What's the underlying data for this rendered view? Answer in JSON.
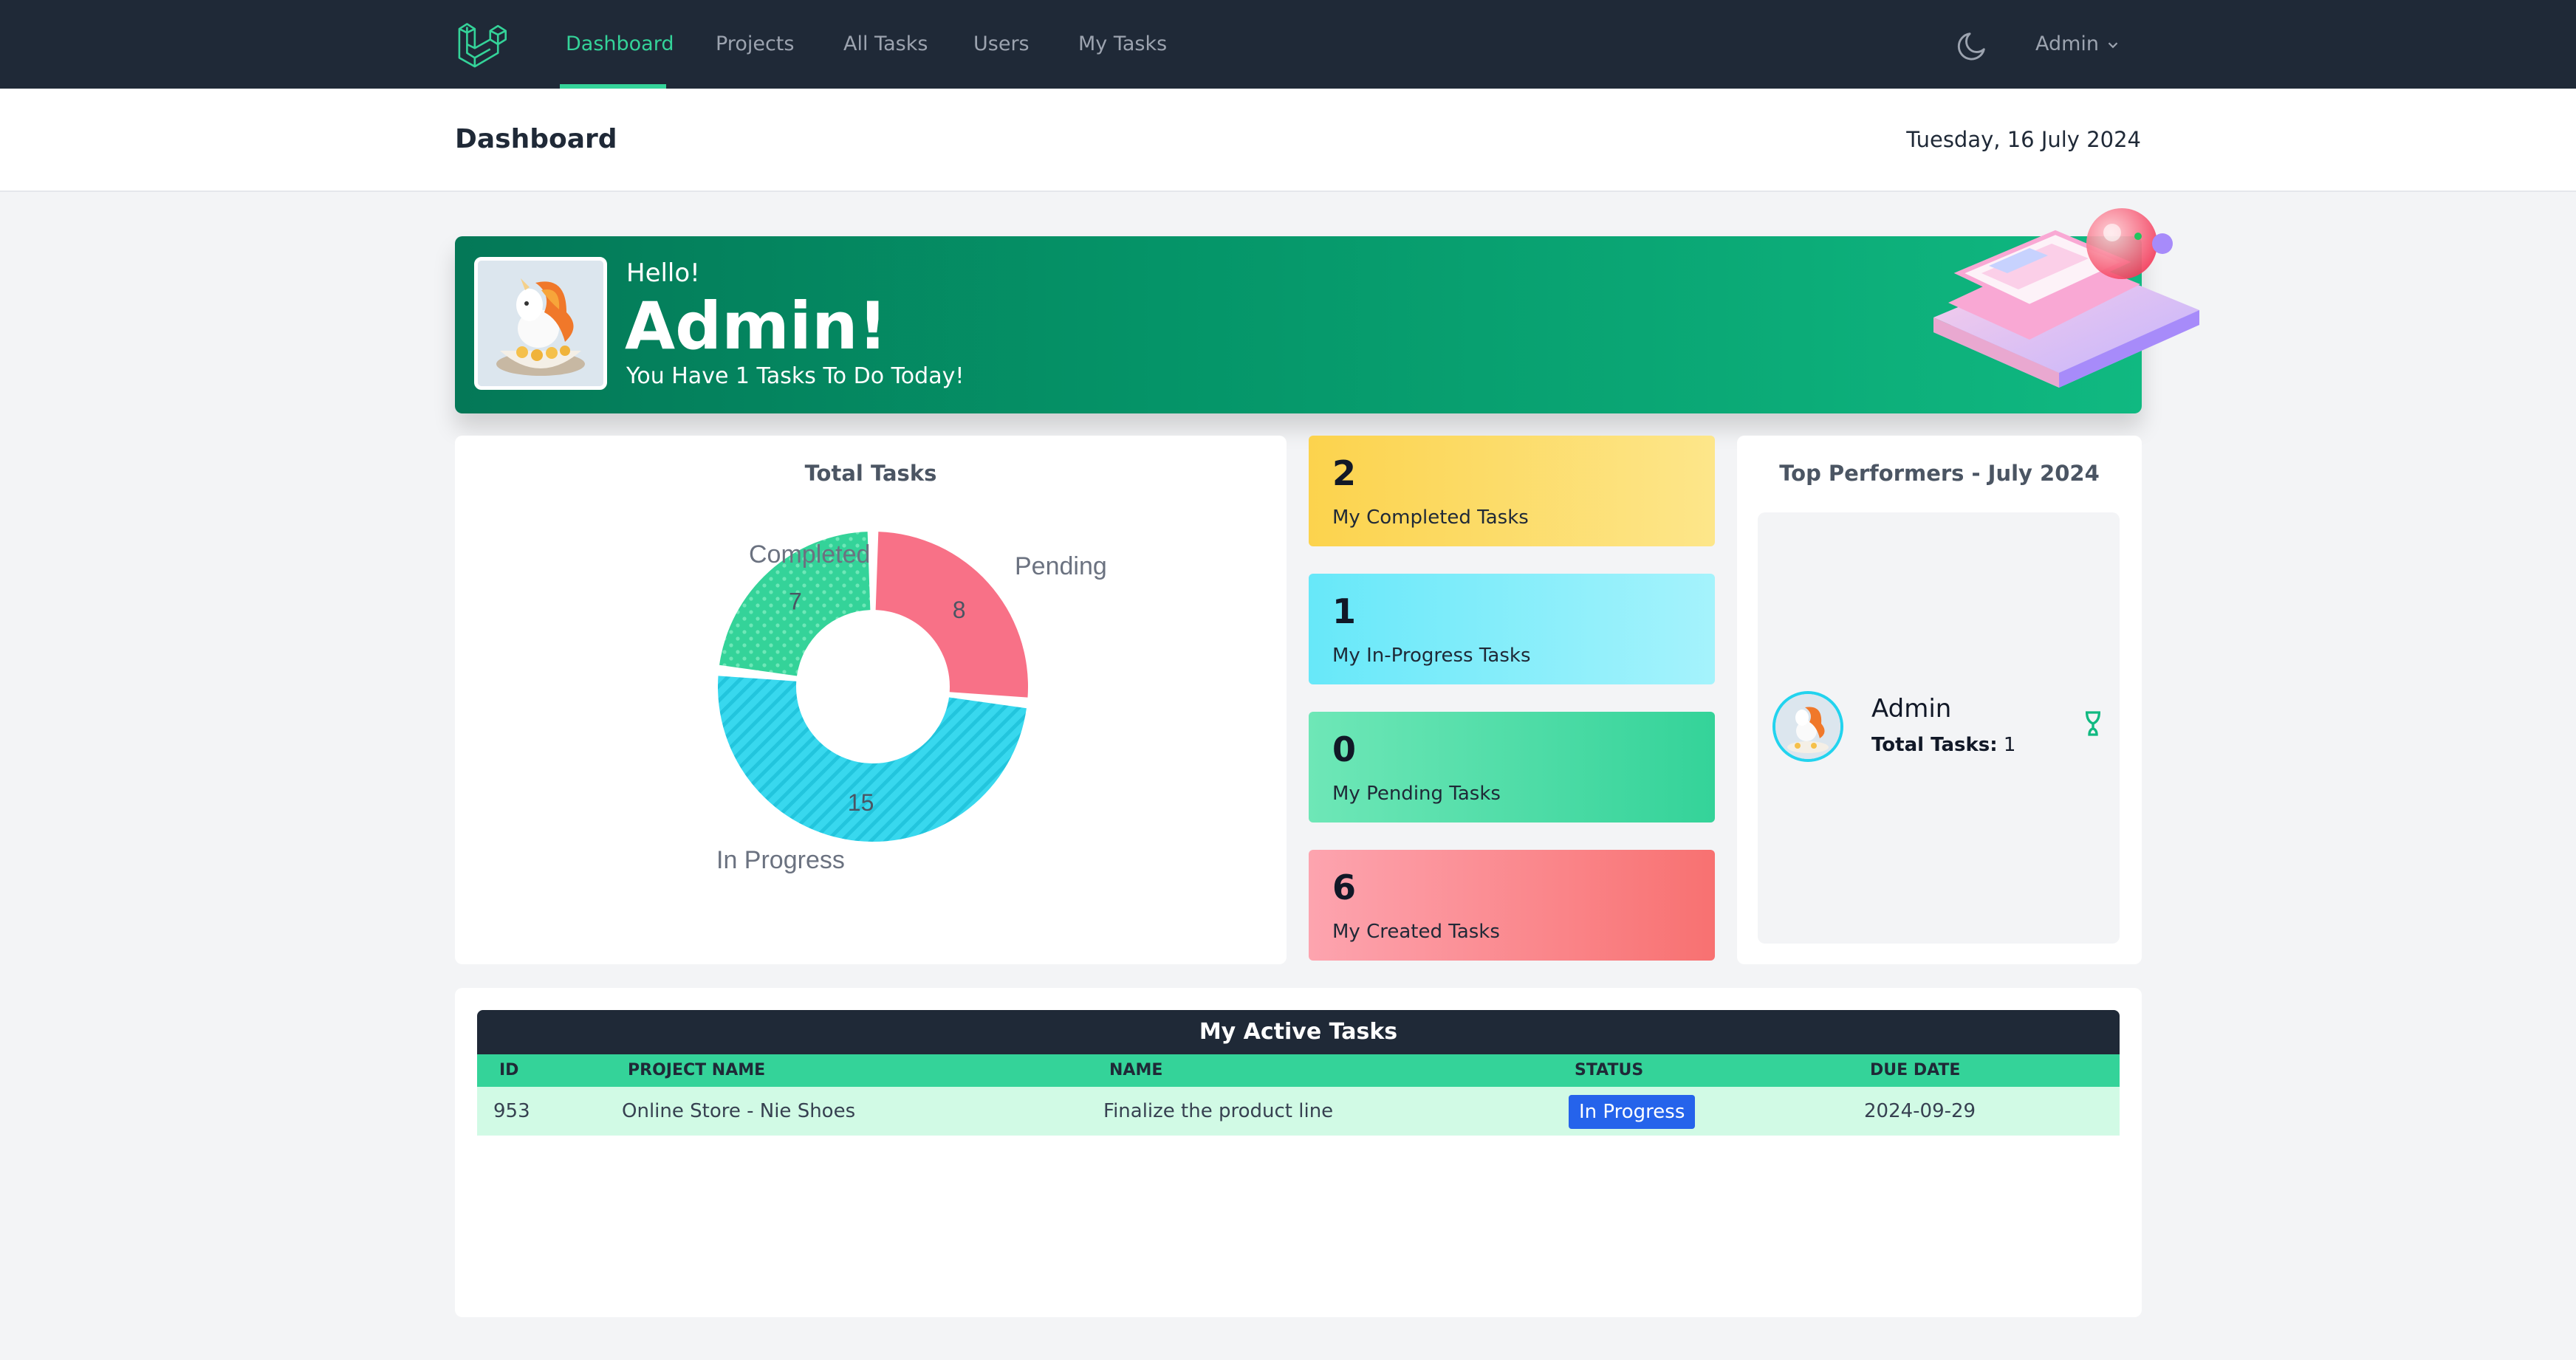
{
  "nav": {
    "items": [
      {
        "label": "Dashboard",
        "active": true
      },
      {
        "label": "Projects",
        "active": false
      },
      {
        "label": "All Tasks",
        "active": false
      },
      {
        "label": "Users",
        "active": false
      },
      {
        "label": "My Tasks",
        "active": false
      }
    ],
    "user": "Admin",
    "accent_color": "#34d399"
  },
  "header": {
    "title": "Dashboard",
    "date": "Tuesday, 16 July 2024"
  },
  "banner": {
    "greeting": "Hello!",
    "name": "Admin!",
    "subtitle": "You Have 1 Tasks To Do Today!"
  },
  "total_tasks": {
    "title": "Total Tasks"
  },
  "chart_data": {
    "type": "pie",
    "title": "Total Tasks",
    "categories": [
      "Pending",
      "In Progress",
      "Completed"
    ],
    "values": [
      8,
      15,
      7
    ],
    "colors": [
      "#f87187",
      "#38d8ee",
      "#34d399"
    ],
    "donut": true
  },
  "stats": [
    {
      "value": "2",
      "label": "My Completed Tasks",
      "from": "#fcd34d",
      "to": "#fde68a"
    },
    {
      "value": "1",
      "label": "My In-Progress Tasks",
      "from": "#67e8f9",
      "to": "#a5f3fc"
    },
    {
      "value": "0",
      "label": "My Pending Tasks",
      "from": "#6ee7b7",
      "to": "#34d399"
    },
    {
      "value": "6",
      "label": "My Created Tasks",
      "from": "#fda4af",
      "to": "#f87171"
    }
  ],
  "top_performers": {
    "title": "Top Performers - July 2024",
    "items": [
      {
        "name": "Admin",
        "tasks_label": "Total Tasks:",
        "tasks": "1"
      }
    ]
  },
  "active_tasks": {
    "title": "My Active Tasks",
    "columns": [
      "ID",
      "PROJECT NAME",
      "NAME",
      "STATUS",
      "DUE DATE"
    ],
    "rows": [
      {
        "id": "953",
        "project": "Online Store - Nie Shoes",
        "name": "Finalize the product line",
        "status": "In Progress",
        "due": "2024-09-29"
      }
    ]
  }
}
